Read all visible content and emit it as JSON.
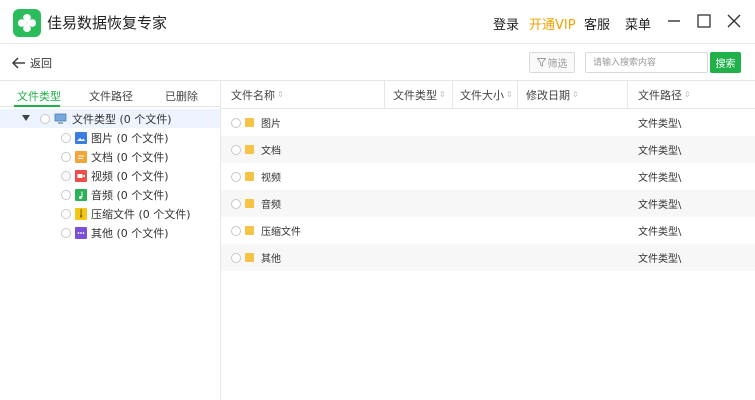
{
  "app": {
    "title": "佳易数据恢复专家"
  },
  "topnav": {
    "login": "登录",
    "vip": "开通VIP",
    "service": "客服",
    "menu": "菜单"
  },
  "toolbar": {
    "back_label": "返回",
    "filter_label": "筛选",
    "search_placeholder": "请输入搜索内容",
    "search_value": "",
    "search_button": "搜索"
  },
  "tabs": [
    {
      "label": "文件类型",
      "active": true
    },
    {
      "label": "文件路径",
      "active": false
    },
    {
      "label": "已删除",
      "active": false
    }
  ],
  "tree": {
    "root": {
      "label": "文件类型 (0 个文件)",
      "expanded": true,
      "selected": false
    },
    "children": [
      {
        "label": "图片 (0 个文件)",
        "icon": "image-icon",
        "color": "#3b7de0",
        "checked": false
      },
      {
        "label": "文档 (0 个文件)",
        "icon": "document-icon",
        "color": "#f3a53a",
        "checked": false
      },
      {
        "label": "视频 (0 个文件)",
        "icon": "video-icon",
        "color": "#e8504a",
        "checked": false
      },
      {
        "label": "音频 (0 个文件)",
        "icon": "audio-icon",
        "color": "#2cb256",
        "checked": false
      },
      {
        "label": "压缩文件 (0 个文件)",
        "icon": "archive-icon",
        "color": "#f5c518",
        "checked": false
      },
      {
        "label": "其他 (0 个文件)",
        "icon": "other-icon",
        "color": "#7b4fd6",
        "checked": false
      }
    ]
  },
  "table": {
    "columns": [
      "文件名称",
      "文件类型",
      "文件大小",
      "修改日期",
      "文件路径"
    ],
    "rows": [
      {
        "name": "图片",
        "type": "",
        "size": "",
        "date": "",
        "path": "文件类型\\"
      },
      {
        "name": "文档",
        "type": "",
        "size": "",
        "date": "",
        "path": "文件类型\\"
      },
      {
        "name": "视频",
        "type": "",
        "size": "",
        "date": "",
        "path": "文件类型\\"
      },
      {
        "name": "音频",
        "type": "",
        "size": "",
        "date": "",
        "path": "文件类型\\"
      },
      {
        "name": "压缩文件",
        "type": "",
        "size": "",
        "date": "",
        "path": "文件类型\\"
      },
      {
        "name": "其他",
        "type": "",
        "size": "",
        "date": "",
        "path": "文件类型\\"
      }
    ]
  },
  "colors": {
    "accent": "#21b14b",
    "vip": "#f4a100",
    "folder": "#f6c445",
    "selection": "#eef4ff"
  }
}
